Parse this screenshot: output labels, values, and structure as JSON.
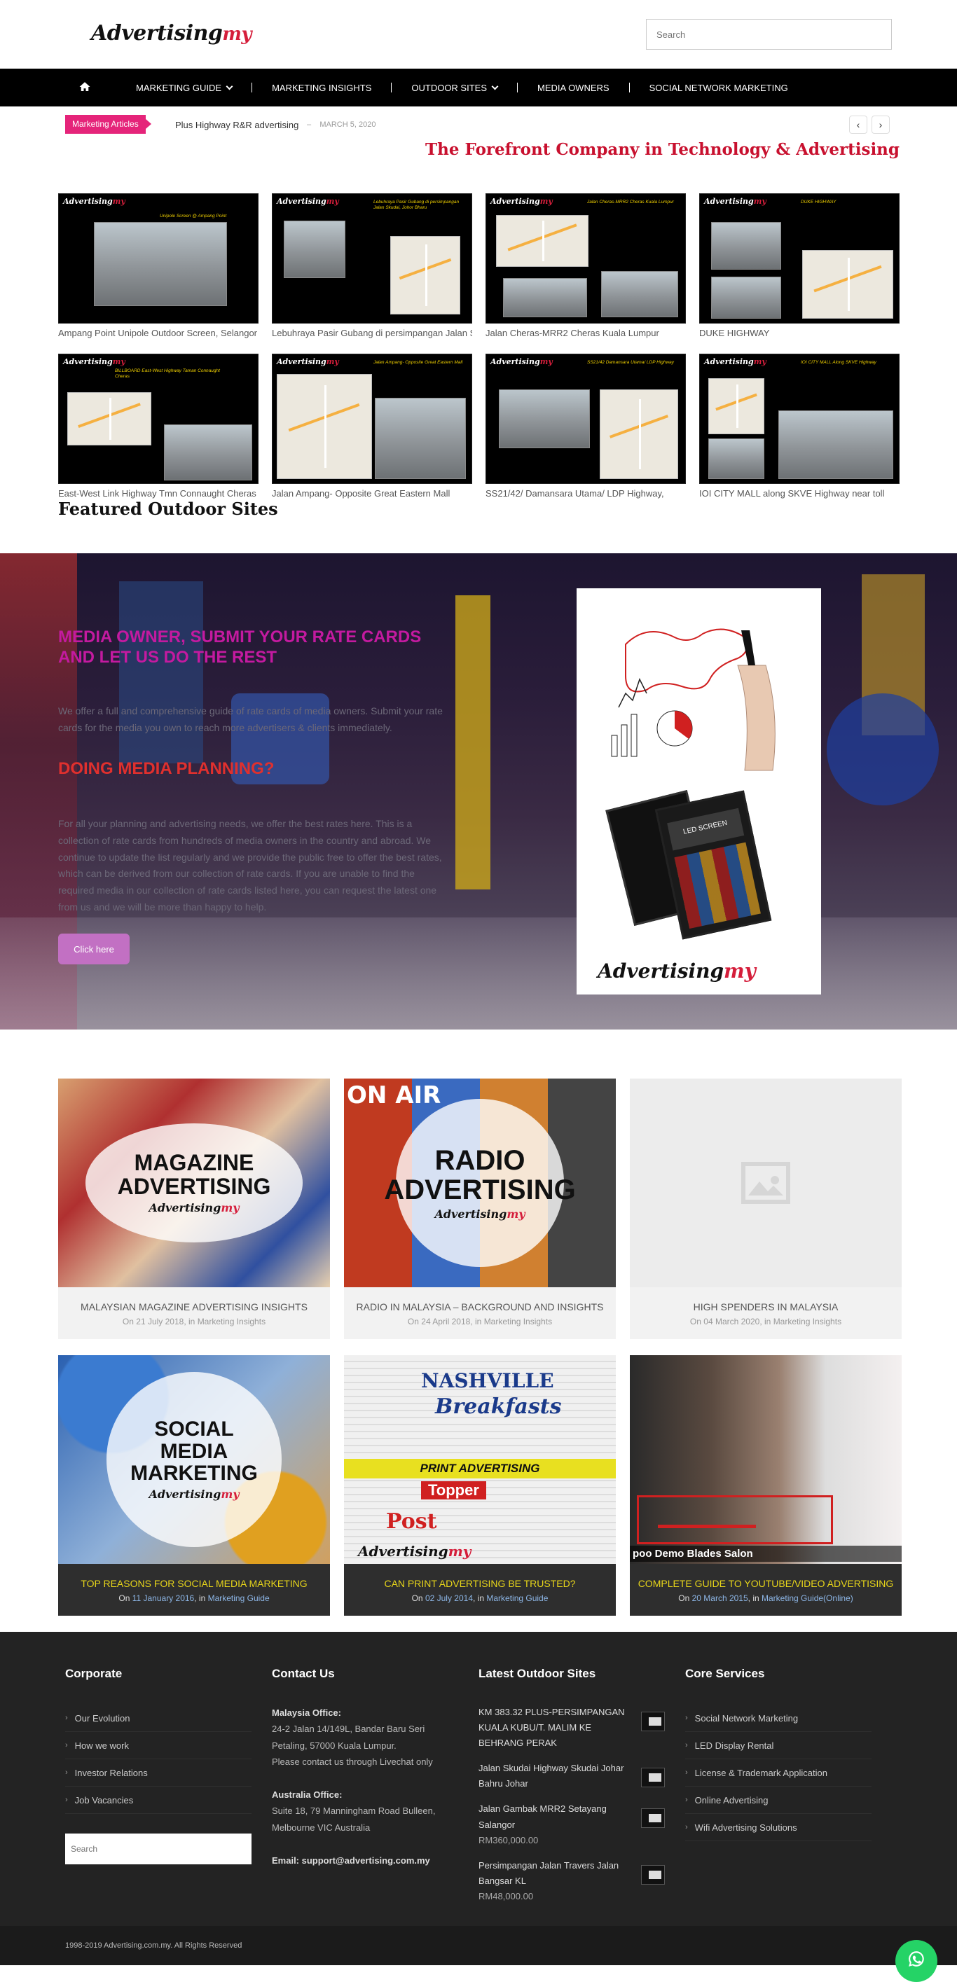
{
  "header": {
    "logo_main": "Advertising",
    "logo_suffix": "my",
    "search_placeholder": "Search"
  },
  "nav": {
    "home_icon": "home-icon",
    "items": [
      {
        "label": "MARKETING GUIDE",
        "dropdown": true
      },
      {
        "label": "MARKETING INSIGHTS",
        "dropdown": false
      },
      {
        "label": "OUTDOOR SITES",
        "dropdown": true
      },
      {
        "label": "MEDIA OWNERS",
        "dropdown": false
      },
      {
        "label": "SOCIAL NETWORK MARKETING",
        "dropdown": false
      }
    ]
  },
  "ticker": {
    "badge": "Marketing Articles",
    "headline": "Plus Highway R&R advertising",
    "separator": "–",
    "date": "MARCH 5, 2020",
    "prev_icon": "chevron-left-icon",
    "next_icon": "chevron-right-icon"
  },
  "tagline": "The Forefront Company in Technology & Advertising",
  "outdoor_sites": [
    {
      "caption": "Ampang Point Unipole Outdoor Screen, Selangor",
      "note": "Unipole Screen @ Ampang Point"
    },
    {
      "caption": "Lebuhraya Pasir Gubang di persimpangan Jalan Skudai",
      "note": "Lebuhraya Pasir Gubang di persimpangan Jalan Skudai, Johor Bharu"
    },
    {
      "caption": "Jalan Cheras-MRR2 Cheras Kuala Lumpur",
      "note": "Jalan Cheras-MRR2 Cheras Kuala Lumpur"
    },
    {
      "caption": "DUKE HIGHWAY",
      "note": "DUKE HIGHWAY"
    },
    {
      "caption": "East-West Link Highway Tmn Connaught Cheras",
      "note": "BILLBOARD East-West Highway Taman Connaught Cheras"
    },
    {
      "caption": "Jalan Ampang- Opposite Great Eastern Mall",
      "note": "Jalan Ampang- Opposite Great Eastern Mall"
    },
    {
      "caption": "SS21/42/ Damansara Utama/ LDP Highway,",
      "note": "SS21/42 Damansara Utama/ LDP Highway"
    },
    {
      "caption": "IOI CITY MALL along SKVE Highway near toll",
      "note": "IOI CITY MALL Along SKVE Highway"
    }
  ],
  "featured_title": "Featured Outdoor Sites",
  "banner": {
    "heading1": "MEDIA OWNER, SUBMIT YOUR RATE CARDS AND LET US DO THE REST",
    "text1": "We offer a full and comprehensive guide of rate cards of media owners. Submit your rate cards for the media you own to reach more advertisers & clients immediately.",
    "heading2": "DOING MEDIA PLANNING?",
    "text2": "For all your planning and advertising needs, we offer the best rates here. This is a collection of rate cards from hundreds of media owners in the country and abroad. We continue to update the list regularly and we provide the public free to offer the best rates, which can be derived from our collection of rate cards. If you are unable to find the required media in our collection of rate cards listed here, you can request the latest one from us and we will be more than happy to help.",
    "button": "Click here",
    "promo_screen": "LED SCREEN",
    "promo_logo": "Advertising",
    "promo_logo_suffix": "my"
  },
  "articles": [
    {
      "title": "MALAYSIAN MAGAZINE ADVERTISING INSIGHTS",
      "on": "On",
      "date": "21 July 2018",
      "in": ", in",
      "category": "Marketing Insights",
      "overlay": "MAGAZINE ADVERTISING",
      "style": "light"
    },
    {
      "title": "RADIO IN MALAYSIA – BACKGROUND AND INSIGHTS",
      "on": "On",
      "date": "24 April 2018",
      "in": ", in",
      "category": "Marketing Insights",
      "overlay": "RADIO ADVERTISING",
      "style": "light"
    },
    {
      "title": "HIGH SPENDERS IN MALAYSIA",
      "on": "On",
      "date": "04 March 2020",
      "in": ", in",
      "category": "Marketing Insights",
      "overlay": "",
      "style": "light"
    },
    {
      "title": "TOP REASONS FOR SOCIAL MEDIA MARKETING",
      "on": "On",
      "date": "11 January 2016",
      "in": ", in",
      "category": "Marketing Guide",
      "overlay": "SOCIAL MEDIA MARKETING",
      "style": "dark"
    },
    {
      "title": "CAN PRINT ADVERTISING BE TRUSTED?",
      "on": "On",
      "date": "02 July 2014",
      "in": ", in",
      "category": "Marketing Guide",
      "overlay": "PRINT ADVERTISING",
      "style": "dark"
    },
    {
      "title": "COMPLETE GUIDE TO YOUTUBE/VIDEO ADVERTISING",
      "on": "On",
      "date": "20 March 2015",
      "in": ", in",
      "category": "Marketing Guide(Online)",
      "overlay": "",
      "style": "dark"
    }
  ],
  "article_image_text": {
    "nashville": "NASHVILLE",
    "breakfasts": "Breakfasts",
    "topper": "Topper",
    "post": "Post",
    "on_air": "ON AIR",
    "salon": "poo Demo Blades Salon"
  },
  "footer": {
    "corporate": {
      "title": "Corporate",
      "links": [
        "Our Evolution",
        "How we work",
        "Investor Relations",
        "Job Vacancies"
      ],
      "search_placeholder": "Search"
    },
    "contact": {
      "title": "Contact Us",
      "my_label": "Malaysia Office:",
      "my_address": "24-2 Jalan 14/149L, Bandar Baru Seri Petaling, 57000 Kuala Lumpur.",
      "my_note": "Please contact us through Livechat only",
      "au_label": "Australia Office:",
      "au_address": "Suite 18, 79 Manningham Road Bulleen, Melbourne VIC Australia",
      "email": "Email: support@advertising.com.my"
    },
    "latest": {
      "title": "Latest Outdoor Sites",
      "items": [
        {
          "name": "KM 383.32 PLUS-PERSIMPANGAN KUALA KUBU/T. MALIM KE BEHRANG PERAK",
          "price": ""
        },
        {
          "name": "Jalan Skudai Highway Skudai Johar Bahru Johar",
          "price": ""
        },
        {
          "name": "Jalan Gambak MRR2 Setayang Salangor",
          "price": "RM360,000.00"
        },
        {
          "name": "Persimpangan Jalan Travers Jalan Bangsar KL",
          "price": "RM48,000.00"
        }
      ]
    },
    "services": {
      "title": "Core Services",
      "links": [
        "Social Network Marketing",
        "LED Display Rental",
        "License & Trademark Application",
        "Online Advertising",
        "Wifi Advertising Solutions"
      ]
    },
    "copyright": "1998-2019 Advertising.com.my. All Rights Reserved"
  },
  "colors": {
    "accent_red": "#c8102e",
    "badge_pink": "#e5247a",
    "banner_heading_pink": "#c41aa0",
    "banner_heading_red": "#e0302e",
    "button_purple": "#c270c3",
    "article_dark_title": "#e8d61a",
    "whatsapp_green": "#25d366"
  }
}
